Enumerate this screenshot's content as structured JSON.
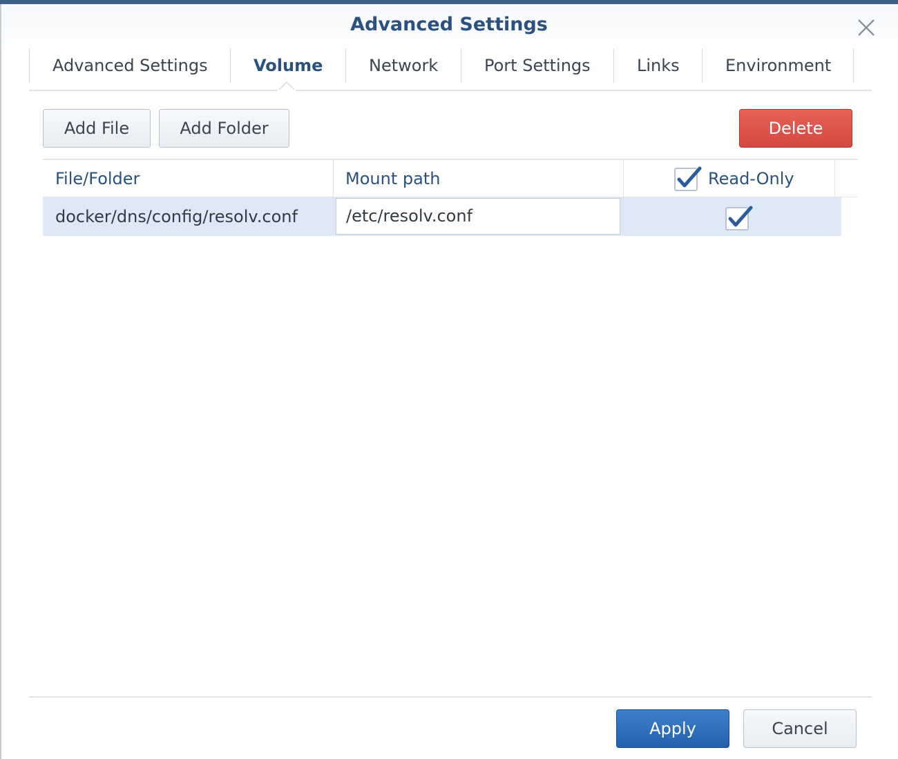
{
  "dialog": {
    "title": "Advanced Settings",
    "close_icon": "close-icon"
  },
  "tabs": [
    {
      "label": "Advanced Settings",
      "active": false
    },
    {
      "label": "Volume",
      "active": true
    },
    {
      "label": "Network",
      "active": false
    },
    {
      "label": "Port Settings",
      "active": false
    },
    {
      "label": "Links",
      "active": false
    },
    {
      "label": "Environment",
      "active": false
    }
  ],
  "toolbar": {
    "add_file_label": "Add File",
    "add_folder_label": "Add Folder",
    "delete_label": "Delete"
  },
  "table": {
    "columns": {
      "file_folder": "File/Folder",
      "mount_path": "Mount path",
      "read_only": "Read-Only"
    },
    "header_read_only_checked": true,
    "rows": [
      {
        "file_folder": "docker/dns/config/resolv.conf",
        "mount_path": "/etc/resolv.conf",
        "read_only": true,
        "selected": true
      }
    ]
  },
  "footer": {
    "apply_label": "Apply",
    "cancel_label": "Cancel"
  },
  "colors": {
    "accent": "#2a5180",
    "danger": "#d9534f",
    "primary": "#2f6fbf",
    "selected_row": "#dde9f7"
  }
}
